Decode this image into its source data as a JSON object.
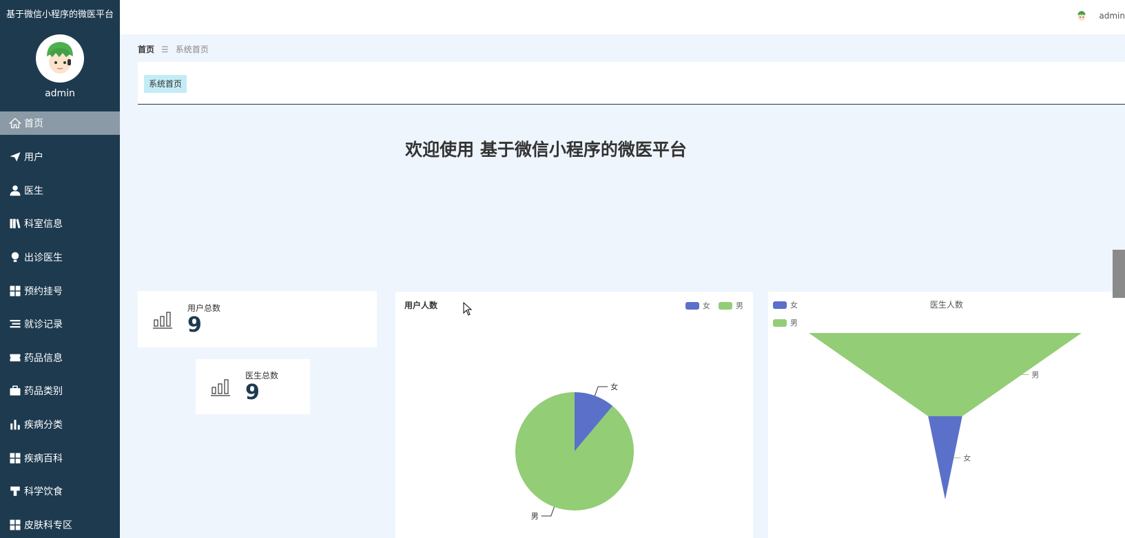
{
  "app": {
    "title": "基于微信小程序的微医平台"
  },
  "user": {
    "name": "admin"
  },
  "topbar": {
    "username": "admin"
  },
  "menu": [
    {
      "label": "首页",
      "icon": "home-icon",
      "active": true
    },
    {
      "label": "用户",
      "icon": "paper-plane-icon"
    },
    {
      "label": "医生",
      "icon": "person-icon"
    },
    {
      "label": "科室信息",
      "icon": "book-icon"
    },
    {
      "label": "出诊医生",
      "icon": "bulb-icon"
    },
    {
      "label": "预约挂号",
      "icon": "grid-icon"
    },
    {
      "label": "就诊记录",
      "icon": "list-icon"
    },
    {
      "label": "药品信息",
      "icon": "ticket-icon"
    },
    {
      "label": "药品类别",
      "icon": "briefcase-icon"
    },
    {
      "label": "疾病分类",
      "icon": "bar-chart-icon"
    },
    {
      "label": "疾病百科",
      "icon": "grid-icon"
    },
    {
      "label": "科学饮食",
      "icon": "tools-icon"
    },
    {
      "label": "皮肤科专区",
      "icon": "grid-icon"
    }
  ],
  "breadcrumb": {
    "home": "首页",
    "separator": "☰",
    "current": "系统首页"
  },
  "tabs": [
    {
      "label": "系统首页"
    }
  ],
  "welcome": "欢迎使用 基于微信小程序的微医平台",
  "stats": [
    {
      "label": "用户总数",
      "value": "9"
    },
    {
      "label": "医生总数",
      "value": "9"
    }
  ],
  "colors": {
    "female": "#5b70c9",
    "male": "#93cd76",
    "sidebar": "#1d3a4f"
  },
  "chart_data": [
    {
      "type": "pie",
      "title": "用户人数",
      "legend": [
        "女",
        "男"
      ],
      "legend_position": "top-right",
      "slices": [
        {
          "name": "女",
          "value": 1
        },
        {
          "name": "男",
          "value": 8
        }
      ]
    },
    {
      "type": "funnel",
      "title": "医生人数",
      "legend": [
        "女",
        "男"
      ],
      "legend_position": "top-left",
      "stages": [
        {
          "name": "男",
          "value": 8
        },
        {
          "name": "女",
          "value": 1
        }
      ]
    }
  ]
}
